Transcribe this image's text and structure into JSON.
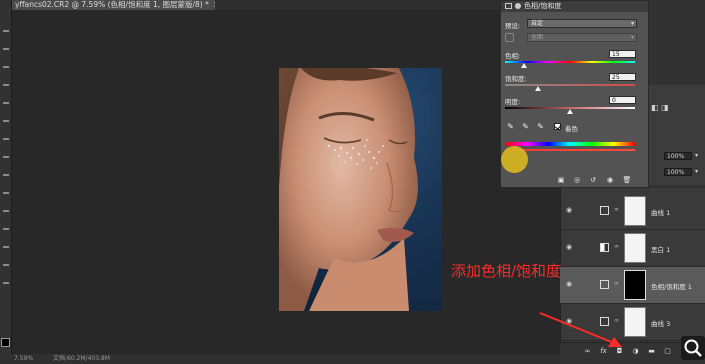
{
  "document": {
    "tab_title": "yffancs02.CR2 @ 7.59% (色相/饱和度 1, 图层蒙版/8) *",
    "close": "×"
  },
  "status_bar": {
    "zoom": "7.59%",
    "doc_info": "文档:60.2M/403.8M"
  },
  "properties": {
    "header_title": "色相/饱和度",
    "preset_label": "预设:",
    "preset_value": "自定",
    "channel_value": "全图",
    "hue_label": "色相:",
    "hue_value": "15",
    "saturation_label": "饱和度:",
    "saturation_value": "25",
    "lightness_label": "明度:",
    "lightness_value": "0",
    "colorize_label": "着色",
    "colorize_checked": true,
    "spectrum_colors": [
      "#ff0000",
      "#ff00ff",
      "#0000ff",
      "#00ffff",
      "#00ff00",
      "#ffff00"
    ]
  },
  "right_dock": {
    "opacity_value": "100%",
    "fill_value": "100%"
  },
  "layers": [
    {
      "name": "曲线 1",
      "type": "curves",
      "mask": "white",
      "active": false
    },
    {
      "name": "黑白 1",
      "type": "black-white",
      "mask": "white",
      "active": false
    },
    {
      "name": "色相/饱和度 1",
      "type": "hue-saturation",
      "mask": "black",
      "active": true
    },
    {
      "name": "曲线 3",
      "type": "curves",
      "mask": "white",
      "active": false
    }
  ],
  "layers_footer": {
    "fx_label": "fx"
  },
  "annotation": {
    "text": "添加色相/饱和度",
    "color": "#ff2a2a"
  }
}
